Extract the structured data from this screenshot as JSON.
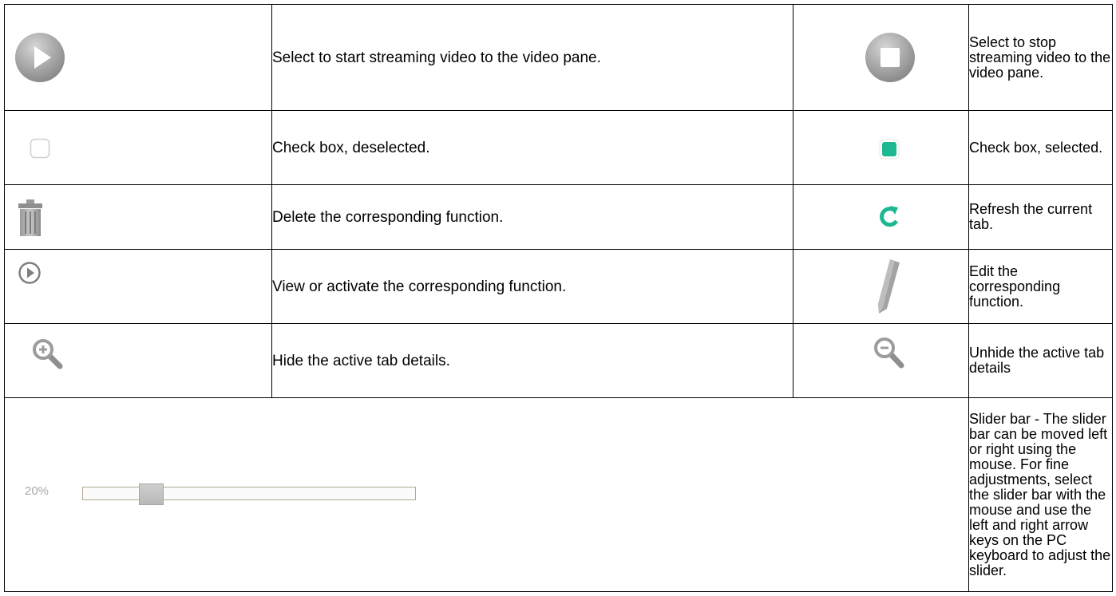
{
  "rows": [
    {
      "left_icon": "play-circle-icon",
      "left_text": "Select to start streaming video to the video pane.",
      "right_icon": "stop-circle-icon",
      "right_text": "Select to stop streaming video to the video pane."
    },
    {
      "left_icon": "checkbox-empty-icon",
      "left_text": "Check box, deselected.",
      "right_icon": "checkbox-checked-icon",
      "right_text": "Check box, selected."
    },
    {
      "left_icon": "trash-icon",
      "left_text": "Delete the corresponding function.",
      "right_icon": "refresh-icon",
      "right_text": "Refresh the current tab."
    },
    {
      "left_icon": "play-outline-icon",
      "left_text": "View or activate the corresponding function.",
      "right_icon": "pencil-icon",
      "right_text": "Edit the corresponding function."
    },
    {
      "left_icon": "zoom-in-icon",
      "left_text": "Hide the active tab details.",
      "right_icon": "zoom-out-icon",
      "right_text": "Unhide the active tab details"
    }
  ],
  "slider": {
    "value_label": "20%",
    "value": 0.2,
    "description": "Slider bar - The slider bar can be moved left or right using the mouse. For fine adjustments, select the slider bar with the mouse and use the left and right arrow keys on the PC keyboard to adjust the slider."
  },
  "colors": {
    "accent": "#1db892",
    "icon_gray": "#8c8c8c"
  }
}
